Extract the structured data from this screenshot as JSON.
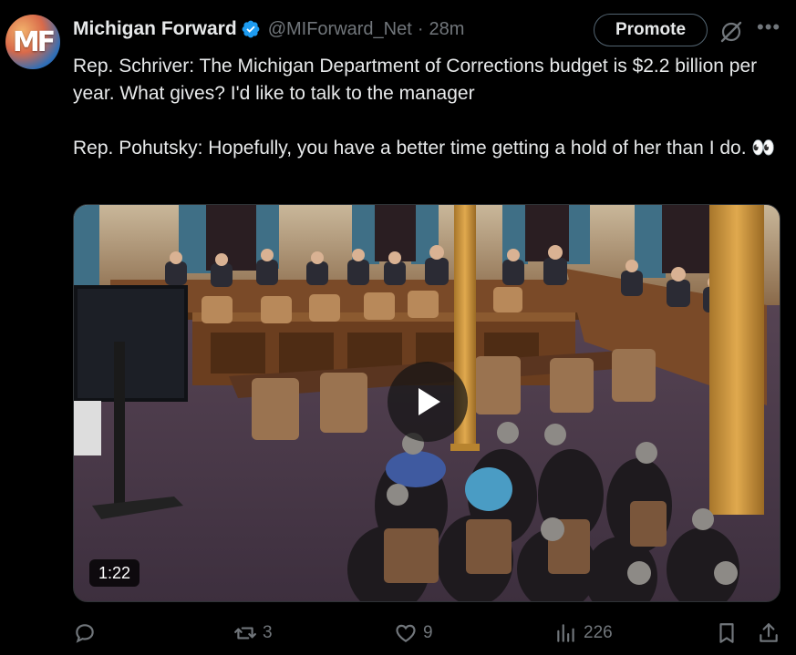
{
  "account": {
    "avatar_text": "MF",
    "name": "Michigan Forward",
    "handle": "@MIForward_Net",
    "separator": "·",
    "time": "28m"
  },
  "header": {
    "promote_label": "Promote"
  },
  "tweet": {
    "text": "Rep. Schriver: The Michigan Department of Corrections budget is $2.2 billion per year. What gives? I'd like to talk to the manager\n\nRep. Pohutsky: Hopefully, you have a better time getting a hold of her than I do. 👀"
  },
  "video": {
    "duration": "1:22"
  },
  "actions": {
    "replies": "",
    "reposts": "3",
    "likes": "9",
    "views": "226"
  },
  "colors": {
    "background": "#000000",
    "text": "#e7e9ea",
    "secondary": "#71767b",
    "verified": "#1d9bf0"
  }
}
